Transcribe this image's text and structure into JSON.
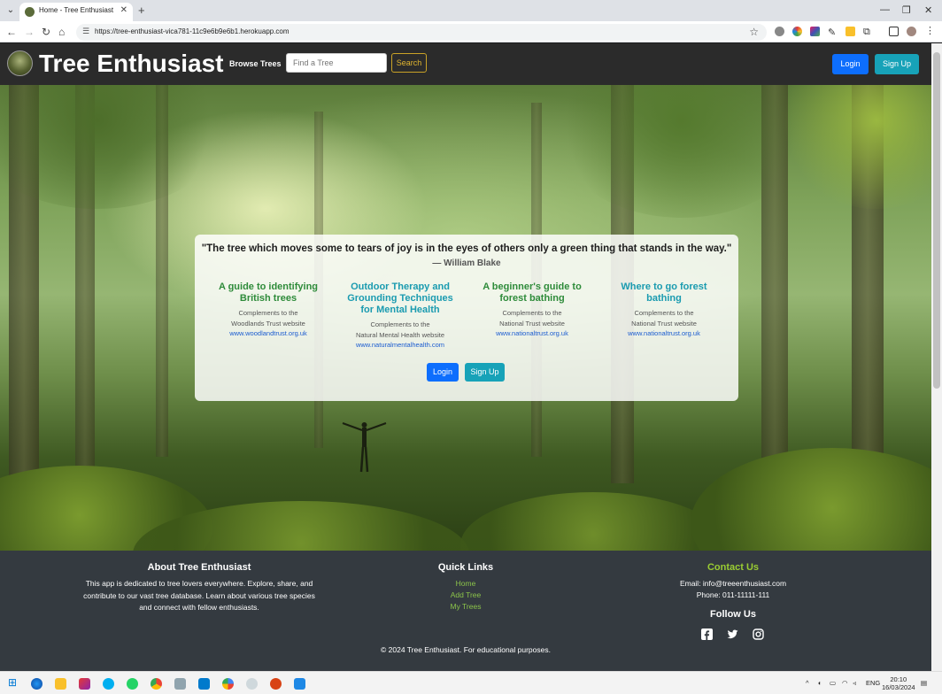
{
  "browser": {
    "tab_title": "Home - Tree Enthusiast",
    "url": "https://tree-enthusiast-vica781-11c9e6b9e6b1.herokuapp.com",
    "tab_close": "✕",
    "new_tab": "+"
  },
  "header": {
    "brand": "Tree Enthusiast",
    "browse_label": "Browse Trees",
    "search_placeholder": "Find a Tree",
    "search_button": "Search",
    "login_label": "Login",
    "signup_label": "Sign Up"
  },
  "hero": {
    "quote": "\"The tree which moves some to tears of joy is in the eyes of others only a green thing that stands in the way.\"",
    "author": "— William Blake",
    "resources": [
      {
        "title": "A guide to identifying British trees",
        "line1": "Complements to the",
        "line2": "Woodlands Trust website",
        "link": "www.woodlandtrust.org.uk",
        "color": "green"
      },
      {
        "title": "Outdoor Therapy and Grounding Techniques for Mental Health",
        "line1": "Complements to the",
        "line2": "Natural Mental Health website",
        "link": "www.naturalmentalhealth.com",
        "color": "teal"
      },
      {
        "title": "A beginner's guide to forest bathing",
        "line1": "Complements to the",
        "line2": "National Trust website",
        "link": "www.nationaltrust.org.uk",
        "color": "green"
      },
      {
        "title": "Where to go forest bathing",
        "line1": "Complements to the",
        "line2": "National Trust website",
        "link": "www.nationaltrust.org.uk",
        "color": "teal"
      }
    ],
    "login_label": "Login",
    "signup_label": "Sign Up"
  },
  "footer": {
    "about_title": "About Tree Enthusiast",
    "about_text": "This app is dedicated to tree lovers everywhere. Explore, share, and contribute to our vast tree database. Learn about various tree species and connect with fellow enthusiasts.",
    "links_title": "Quick Links",
    "links": [
      "Home",
      "Add Tree",
      "My Trees"
    ],
    "contact_title": "Contact Us",
    "email": "Email: info@treeenthusiast.com",
    "phone": "Phone: 011-11111-111",
    "follow_title": "Follow Us",
    "copyright": "© 2024 Tree Enthusiast. For educational purposes."
  },
  "taskbar": {
    "lang": "ENG",
    "time": "20:10",
    "date": "16/03/2024"
  },
  "colors": {
    "primary": "#0d6efd",
    "info": "#17a2b8",
    "warning": "#e0b52f",
    "footer_bg": "#343a40",
    "link_green": "#8bc34a"
  }
}
